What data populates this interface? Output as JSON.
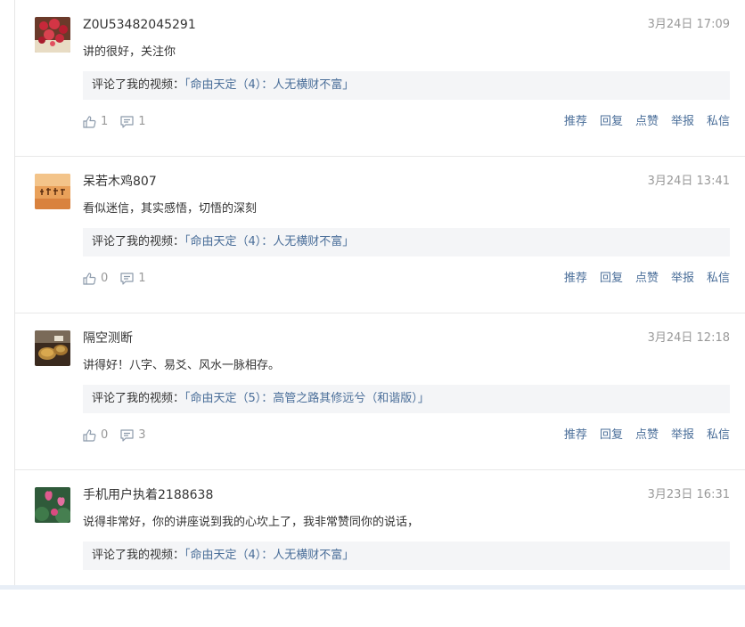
{
  "comments": [
    {
      "username": "Z0U53482045291",
      "time": "3月24日 17:09",
      "text": "讲的很好，关注你",
      "quote_prefix": "评论了我的视频：",
      "video_link": "「命由天定（4）：人无横财不富」",
      "likes": "1",
      "replies": "1",
      "avatar_icon": "red-flowers-avatar"
    },
    {
      "username": "呆若木鸡807",
      "time": "3月24日 13:41",
      "text": "看似迷信，其实感悟，切悟的深刻",
      "quote_prefix": "评论了我的视频：",
      "video_link": "「命由天定（4）：人无横财不富」",
      "likes": "0",
      "replies": "1",
      "avatar_icon": "calligraphy-avatar"
    },
    {
      "username": "隔空测断",
      "time": "3月24日 12:18",
      "text": "讲得好！八字、易爻、风水一脉相存。",
      "quote_prefix": "评论了我的视频：",
      "video_link": "「命由天定（5）：高管之路其修远兮（和谐版）」",
      "likes": "0",
      "replies": "3",
      "avatar_icon": "coins-avatar"
    },
    {
      "username": "手机用户执着2188638",
      "time": "3月23日 16:31",
      "text": "说得非常好，你的讲座说到我的心坎上了，我非常赞同你的说话，",
      "quote_prefix": "评论了我的视频：",
      "video_link": "「命由天定（4）：人无横财不富」",
      "likes": "",
      "replies": "",
      "avatar_icon": "lotus-avatar"
    }
  ],
  "actions": {
    "recommend": "推荐",
    "reply": "回复",
    "like": "点赞",
    "report": "举报",
    "message": "私信"
  },
  "colors": {
    "link": "#4a6e99",
    "muted": "#999999",
    "quote_bg": "#f4f5f7"
  }
}
